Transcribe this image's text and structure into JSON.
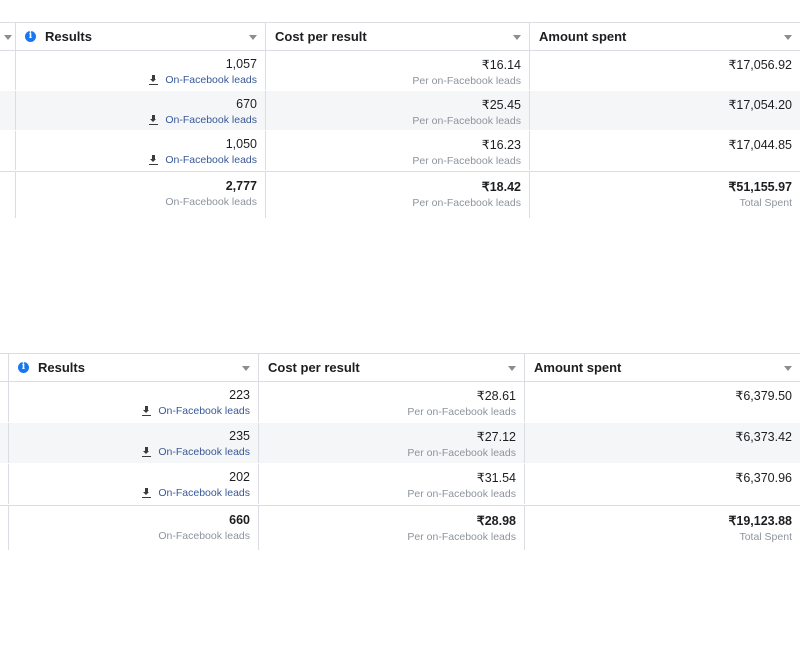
{
  "columns": {
    "results": "Results",
    "cost_per_result": "Cost per result",
    "amount_spent": "Amount spent"
  },
  "tables": [
    {
      "rows": [
        {
          "results": "1,057",
          "result_type": "On-Facebook leads",
          "cost": "₹16.14",
          "cost_sub": "Per on-Facebook leads",
          "spent": "₹17,056.92"
        },
        {
          "results": "670",
          "result_type": "On-Facebook leads",
          "cost": "₹25.45",
          "cost_sub": "Per on-Facebook leads",
          "spent": "₹17,054.20"
        },
        {
          "results": "1,050",
          "result_type": "On-Facebook leads",
          "cost": "₹16.23",
          "cost_sub": "Per on-Facebook leads",
          "spent": "₹17,044.85"
        }
      ],
      "total": {
        "results": "2,777",
        "results_sub": "On-Facebook leads",
        "cost": "₹18.42",
        "cost_sub": "Per on-Facebook leads",
        "spent": "₹51,155.97",
        "spent_sub": "Total Spent"
      }
    },
    {
      "rows": [
        {
          "results": "223",
          "result_type": "On-Facebook leads",
          "cost": "₹28.61",
          "cost_sub": "Per on-Facebook leads",
          "spent": "₹6,379.50"
        },
        {
          "results": "235",
          "result_type": "On-Facebook leads",
          "cost": "₹27.12",
          "cost_sub": "Per on-Facebook leads",
          "spent": "₹6,373.42"
        },
        {
          "results": "202",
          "result_type": "On-Facebook leads",
          "cost": "₹31.54",
          "cost_sub": "Per on-Facebook leads",
          "spent": "₹6,370.96"
        }
      ],
      "total": {
        "results": "660",
        "results_sub": "On-Facebook leads",
        "cost": "₹28.98",
        "cost_sub": "Per on-Facebook leads",
        "spent": "₹19,123.88",
        "spent_sub": "Total Spent"
      }
    }
  ],
  "icons": {
    "info": "info-icon",
    "sort": "caret-down-icon",
    "download": "download-icon"
  },
  "colors": {
    "accent": "#1877f2",
    "link": "#385898",
    "row_shade": "#f5f6f7",
    "border": "#dadde1"
  }
}
